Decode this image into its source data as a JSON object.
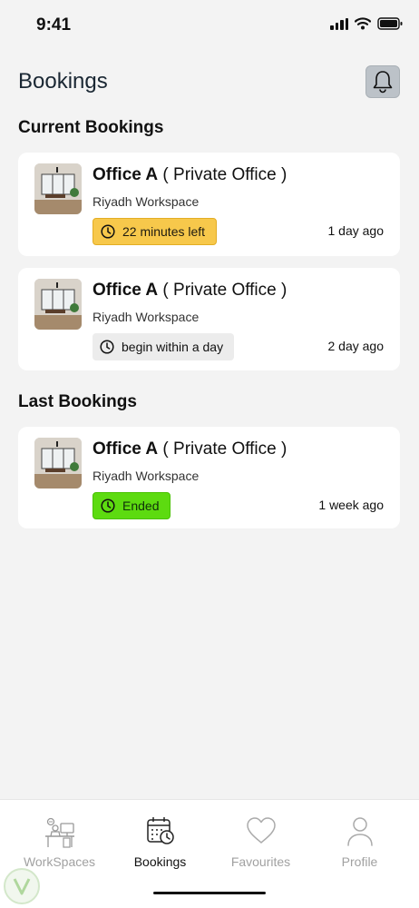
{
  "status_bar": {
    "time": "9:41"
  },
  "header": {
    "title": "Bookings"
  },
  "sections": {
    "current": "Current Bookings",
    "last": "Last Bookings"
  },
  "current_bookings": [
    {
      "name": "Office A",
      "type": " ( Private Office )",
      "location": "Riyadh Workspace",
      "status": "22 minutes left",
      "ago": "1 day ago"
    },
    {
      "name": "Office A",
      "type": " ( Private Office )",
      "location": "Riyadh Workspace",
      "status": "begin within a day",
      "ago": "2 day ago"
    }
  ],
  "last_bookings": [
    {
      "name": "Office A",
      "type": " ( Private Office )",
      "location": "Riyadh Workspace",
      "status": "Ended",
      "ago": "1 week ago"
    }
  ],
  "nav": {
    "workspaces": "WorkSpaces",
    "bookings": "Bookings",
    "favourites": "Favourites",
    "profile": "Profile"
  },
  "colors": {
    "warning": "#f7c84b",
    "success": "#5ddb10",
    "pending": "#ececec"
  }
}
